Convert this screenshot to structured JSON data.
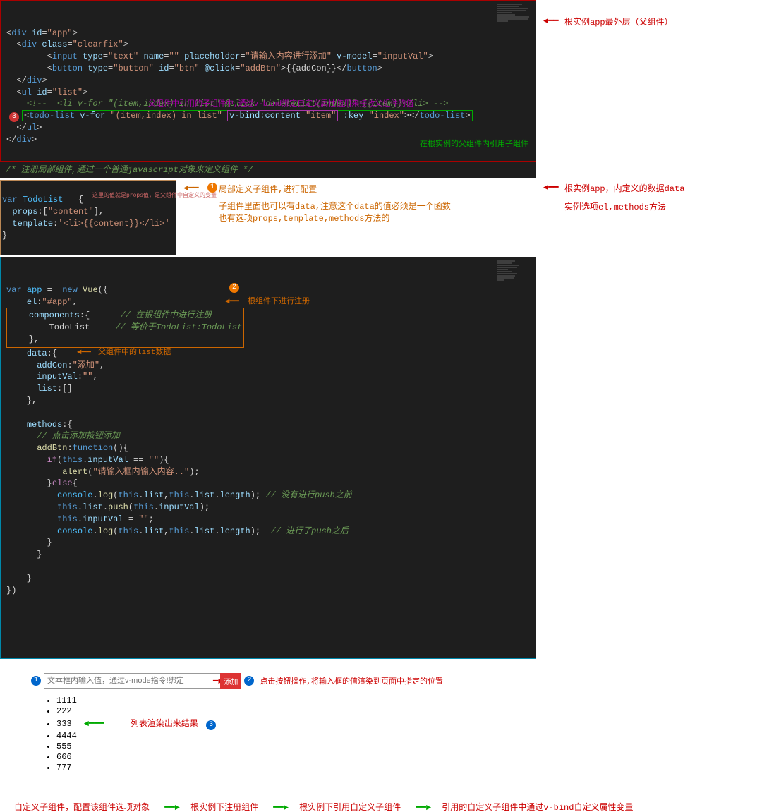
{
  "code1": {
    "l1": "<div id=\"app\">",
    "l2": "  <div class=\"clearfix\">",
    "l3": "        <input type=\"text\" name=\"\" placeholder=\"请输入内容进行添加\" v-model=\"inputVal\">",
    "l4": "        <button type=\"button\" id=\"btn\" @click=\"addBtn\">{{addCon}}</button>",
    "l5": "  </div>",
    "l6": "  <ul id=\"list\">",
    "l7": "    <!--  <li v-for=\"(item,index) in list\" @click=\"deleteList(index)\">{{item}}</li> -->",
    "l8a": "    <todo-list v-for=\"(item,index) in list\" ",
    "l8b": "v-bind:content=\"item\"",
    "l8c": " :key=\"index\"></todo-list>",
    "l9": "  </ul>",
    "l10": "</div>"
  },
  "anno_top_right": "根实例app最外层（父组件）",
  "anno_green_inline": "在根实例的父组件内引用子组件",
  "anno_purple_below": "父组件中引用的子组件中,通过v-bind绑定自定义属性值用来接收父组件的值",
  "cmt_register": "/* 注册局部组件,通过一个普通javascript对象来定义组件 */",
  "todolist": {
    "l1": "var TodoList = {",
    "l2": "  props:[\"content\"],",
    "l3": "  template:'<li>{{content}}</li>'",
    "l4": "}",
    "tiny": "这里的值就是props值，是父组件中自定义的变量"
  },
  "anno_todolist_1": "局部定义子组件,进行配置",
  "anno_todolist_2": "子组件里面也可以有data,注意这个data的值必须是一个函数\n也有选项props,template,methods方法的",
  "vue": {
    "l1": "var app =  new Vue({",
    "l2": "    el:\"#app\",",
    "l3": "    components:{",
    "comp_cmt1": "// 在根组件中进行注册",
    "l4": "        TodoList",
    "comp_cmt2": "// 等价于TodoList:TodoList",
    "l5": "    },",
    "l6": "    data:{",
    "l7": "      addCon:\"添加\",",
    "l8": "      inputVal:\"\",",
    "l9": "      list:[]",
    "l10": "    },",
    "l11": "",
    "l12": "    methods:{",
    "l13": "      // 点击添加按钮添加",
    "l14": "      addBtn:function(){",
    "l15": "        if(this.inputVal == \"\"){",
    "l16": "           alert(\"请输入框内输入内容..\");",
    "l17": "        }else{",
    "l18": "          console.log(this.list,this.list.length); // 没有进行push之前",
    "l19": "          this.list.push(this.inputVal);",
    "l20": "          this.inputVal = \"\";",
    "l21": "          console.log(this.list,this.list.length);  // 进行了push之后",
    "l22": "        }",
    "l23": "      }",
    "l24": "",
    "l25": "    }",
    "l26": "})"
  },
  "anno_comp_reg": "根组件下进行注册",
  "anno_list_data": "父组件中的list数据",
  "anno_side_data": "根实例app，内定义的数据data",
  "anno_side_methods": "实例选项el,methods方法",
  "demo": {
    "input_placeholder": "文本框内输入值，通过v-mode指令!绑定",
    "btn_label": "添加",
    "anno_click": "点击按钮操作,将输入框的值渲染到页面中指定的位置",
    "list": [
      "1111",
      "222",
      "333",
      "4444",
      "555",
      "666",
      "777"
    ],
    "anno_list": "列表渲染出来结果"
  },
  "flow": {
    "s1": "自定义子组件，配置该组件选项对象",
    "s2": "根实例下注册组件",
    "s3": "根实例下引用自定义子组件",
    "s4": "引用的自定义子组件中通过v-bind自定义属性变量"
  }
}
